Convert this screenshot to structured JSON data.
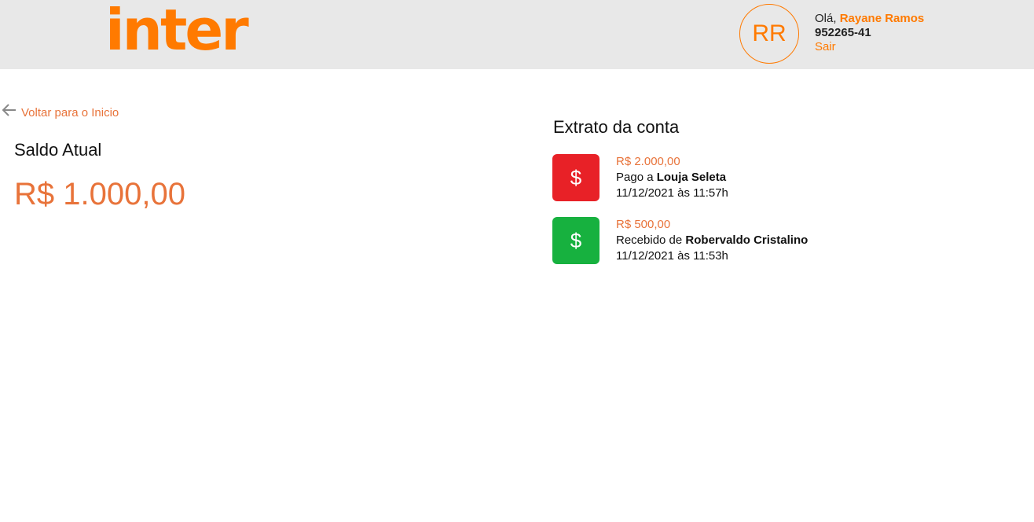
{
  "header": {
    "logo_text": "inter",
    "avatar_initials": "RR",
    "greeting": "Olá,",
    "user_name": "Rayane Ramos",
    "account_number": "952265-41",
    "logout_label": "Sair"
  },
  "navigation": {
    "back_label": "Voltar para o Inicio"
  },
  "balance": {
    "label": "Saldo Atual",
    "value": "R$ 1.000,00"
  },
  "statement": {
    "title": "Extrato da conta",
    "transactions": [
      {
        "amount": "R$ 2.000,00",
        "prefix": "Pago a",
        "party": "Louja Seleta",
        "datetime": "11/12/2021 às 11:57h",
        "icon": "dollar-sign-icon",
        "color": "#e82127"
      },
      {
        "amount": "R$ 500,00",
        "prefix": "Recebido de",
        "party": "Robervaldo Cristalino",
        "datetime": "11/12/2021 às 11:53h",
        "icon": "dollar-sign-icon",
        "color": "#17b13f"
      }
    ]
  },
  "colors": {
    "brand_orange": "#ff7a00",
    "text_orange": "#e8733a",
    "header_bg": "#e8e8e8"
  }
}
